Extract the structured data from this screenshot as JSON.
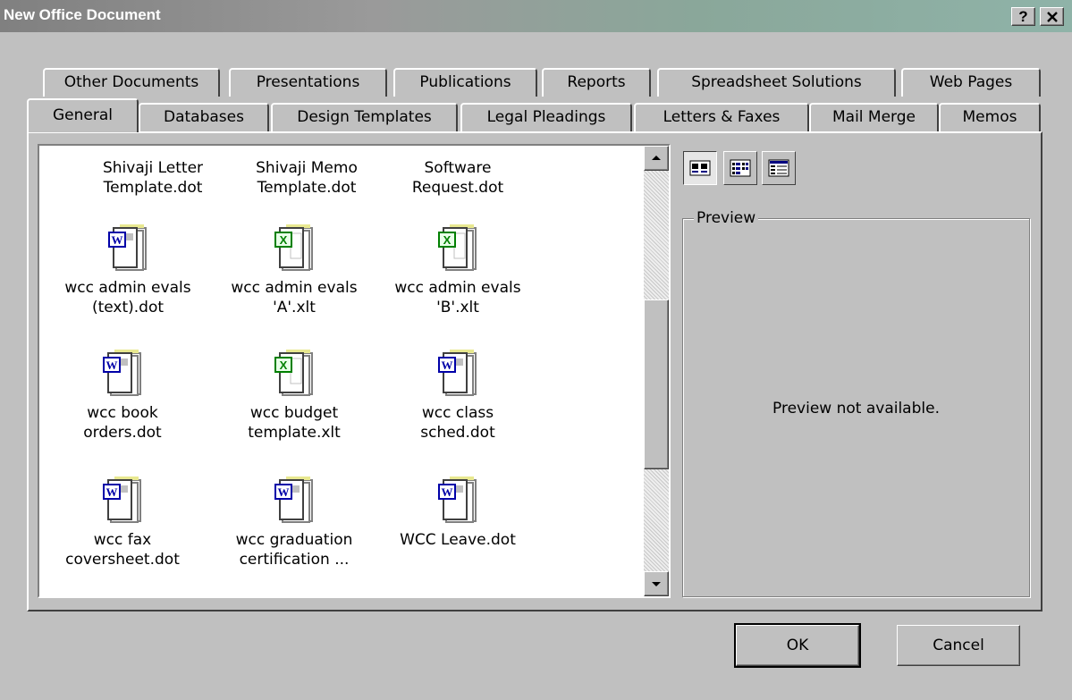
{
  "window": {
    "title": "New Office Document",
    "help_label": "?",
    "close_label": "✕"
  },
  "tabs": {
    "back_row": [
      "Other Documents",
      "Presentations",
      "Publications",
      "Reports",
      "Spreadsheet Solutions",
      "Web Pages"
    ],
    "front_row": [
      "General",
      "Databases",
      "Design Templates",
      "Legal Pleadings",
      "Letters & Faxes",
      "Mail Merge",
      "Memos"
    ],
    "active": "General"
  },
  "templates": [
    {
      "label": "Shivaji Letter Template.dot",
      "line1": "Shivaji Letter",
      "line2": "Template.dot",
      "type": "word"
    },
    {
      "label": "Shivaji Memo Template.dot",
      "line1": "Shivaji Memo",
      "line2": "Template.dot",
      "type": "word"
    },
    {
      "label": "Software Request.dot",
      "line1": "Software",
      "line2": "Request.dot",
      "type": "word"
    },
    {
      "label": "wcc admin evals (text).dot",
      "line1": "wcc admin evals",
      "line2": "(text).dot",
      "type": "word"
    },
    {
      "label": "wcc admin evals 'A'.xlt",
      "line1": "wcc admin evals",
      "line2": "'A'.xlt",
      "type": "excel"
    },
    {
      "label": "wcc admin evals 'B'.xlt",
      "line1": "wcc admin evals",
      "line2": "'B'.xlt",
      "type": "excel"
    },
    {
      "label": "wcc book orders.dot",
      "line1": "wcc book",
      "line2": "orders.dot",
      "type": "word"
    },
    {
      "label": "wcc budget template.xlt",
      "line1": "wcc budget",
      "line2": "template.xlt",
      "type": "excel"
    },
    {
      "label": "wcc class sched.dot",
      "line1": "wcc class",
      "line2": "sched.dot",
      "type": "word"
    },
    {
      "label": "wcc fax coversheet.dot",
      "line1": "wcc fax",
      "line2": "coversheet.dot",
      "type": "word"
    },
    {
      "label": "wcc graduation certification ...",
      "line1": "wcc graduation",
      "line2": "certification ...",
      "type": "word"
    },
    {
      "label": "WCC Leave.dot",
      "line1": "WCC Leave.dot",
      "line2": "",
      "type": "word"
    }
  ],
  "view_buttons": [
    "large-icons-view-icon",
    "list-view-icon",
    "details-view-icon"
  ],
  "preview": {
    "legend": "Preview",
    "message": "Preview not available."
  },
  "buttons": {
    "ok": "OK",
    "cancel": "Cancel"
  },
  "colors": {
    "word_blue": "#0000a8",
    "excel_green": "#008000",
    "title_gradient_end": "#8fb3a8"
  }
}
